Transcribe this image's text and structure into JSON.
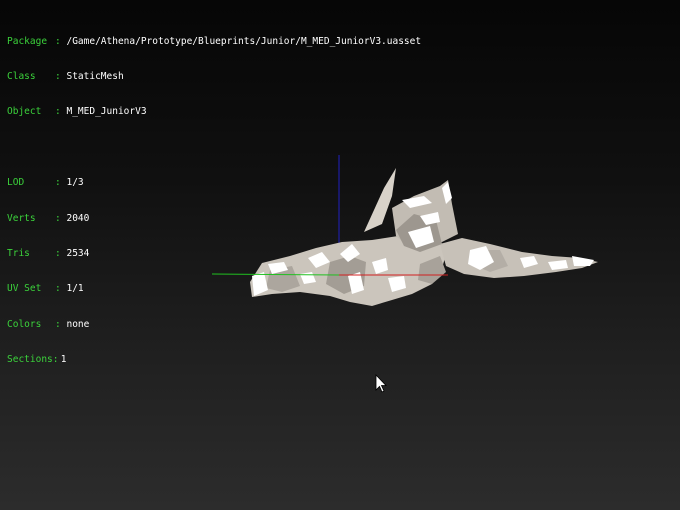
{
  "info": {
    "rows": [
      {
        "label": "Package",
        "value": "/Game/Athena/Prototype/Blueprints/Junior/M_MED_JuniorV3.uasset"
      },
      {
        "label": "Class",
        "value": "StaticMesh"
      },
      {
        "label": "Object",
        "value": "M_MED_JuniorV3"
      },
      {
        "label": "LOD",
        "value": "1/3"
      },
      {
        "label": "Verts",
        "value": "2040"
      },
      {
        "label": "Tris",
        "value": "2534"
      },
      {
        "label": "UV Set",
        "value": "1/1"
      },
      {
        "label": "Colors",
        "value": "none"
      },
      {
        "label": "Sections:",
        "value": "1"
      }
    ],
    "separator": ":"
  },
  "colors": {
    "label": "#3bd23b",
    "value": "#ffffff",
    "axis_x": "#d02020",
    "axis_y": "#20c020",
    "axis_z": "#2020c0",
    "mesh": "#cfc9c0"
  },
  "icons": {
    "cursor": "arrow-cursor-icon"
  }
}
